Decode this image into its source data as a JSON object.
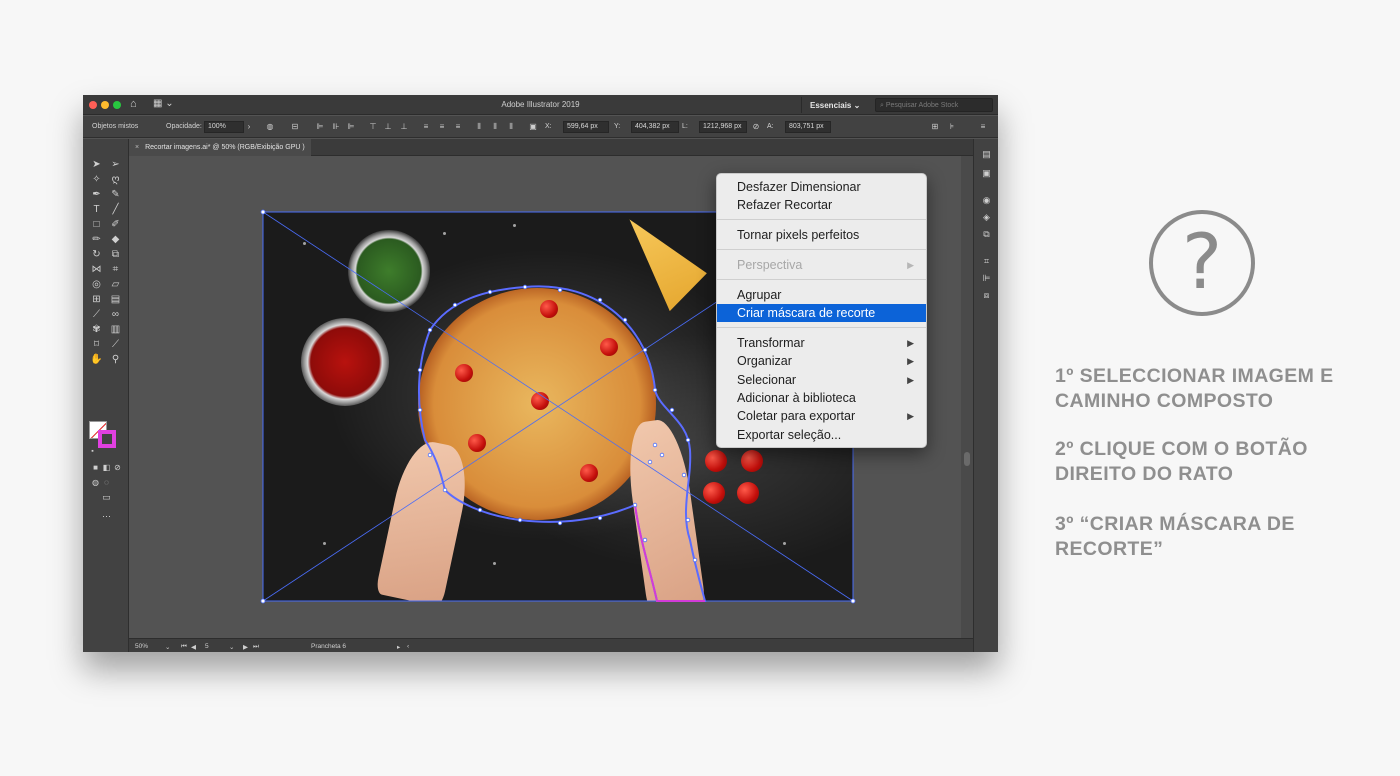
{
  "app": {
    "title": "Adobe Illustrator 2019",
    "workspace": "Essenciais",
    "stock_search_placeholder": "Pesquisar Adobe Stock"
  },
  "control_bar": {
    "selection_type": "Objetos mistos",
    "opacity_label": "Opacidade:",
    "opacity_value": "100%",
    "x_label": "X:",
    "x_value": "599,64 px",
    "y_label": "Y:",
    "y_value": "404,382 px",
    "w_label": "L:",
    "w_value": "1212,968 px",
    "h_label": "A:",
    "h_value": "803,751 px"
  },
  "document_tab": {
    "close": "×",
    "label": "Recortar imagens.ai* @ 50% (RGB/Exibição GPU )"
  },
  "status_bar": {
    "zoom": "50%",
    "artboard_number": "5",
    "artboard_name": "Prancheta 6"
  },
  "context_menu": {
    "items": [
      {
        "label": "Desfazer Dimensionar",
        "state": "normal",
        "submenu": false
      },
      {
        "label": "Refazer Recortar",
        "state": "normal",
        "submenu": false
      },
      {
        "label": "Tornar pixels perfeitos",
        "state": "normal",
        "submenu": false
      },
      {
        "label": "Perspectiva",
        "state": "disabled",
        "submenu": true
      },
      {
        "label": "Agrupar",
        "state": "normal",
        "submenu": false
      },
      {
        "label": "Criar máscara de recorte",
        "state": "active",
        "submenu": false
      },
      {
        "label": "Transformar",
        "state": "normal",
        "submenu": true
      },
      {
        "label": "Organizar",
        "state": "normal",
        "submenu": true
      },
      {
        "label": "Selecionar",
        "state": "normal",
        "submenu": true
      },
      {
        "label": "Adicionar à biblioteca",
        "state": "normal",
        "submenu": false
      },
      {
        "label": "Coletar para exportar",
        "state": "normal",
        "submenu": true
      },
      {
        "label": "Exportar seleção...",
        "state": "normal",
        "submenu": false
      }
    ],
    "submenu_arrow": "▶"
  },
  "instructions": {
    "icon": "question-circle-icon",
    "steps": [
      "1º SELECCIONAR IMAGEM E CAMINHO COMPOSTO",
      "2º CLIQUE COM O BOTÃO DIREITO DO RATO",
      "3º “CRIAR MÁSCARA DE RECORTE”"
    ]
  },
  "colors": {
    "menu_highlight": "#0c63d8",
    "stroke_swatch": "#e040e0",
    "selection": "#4a6cf7",
    "instruction_text": "#8f8f8f"
  }
}
